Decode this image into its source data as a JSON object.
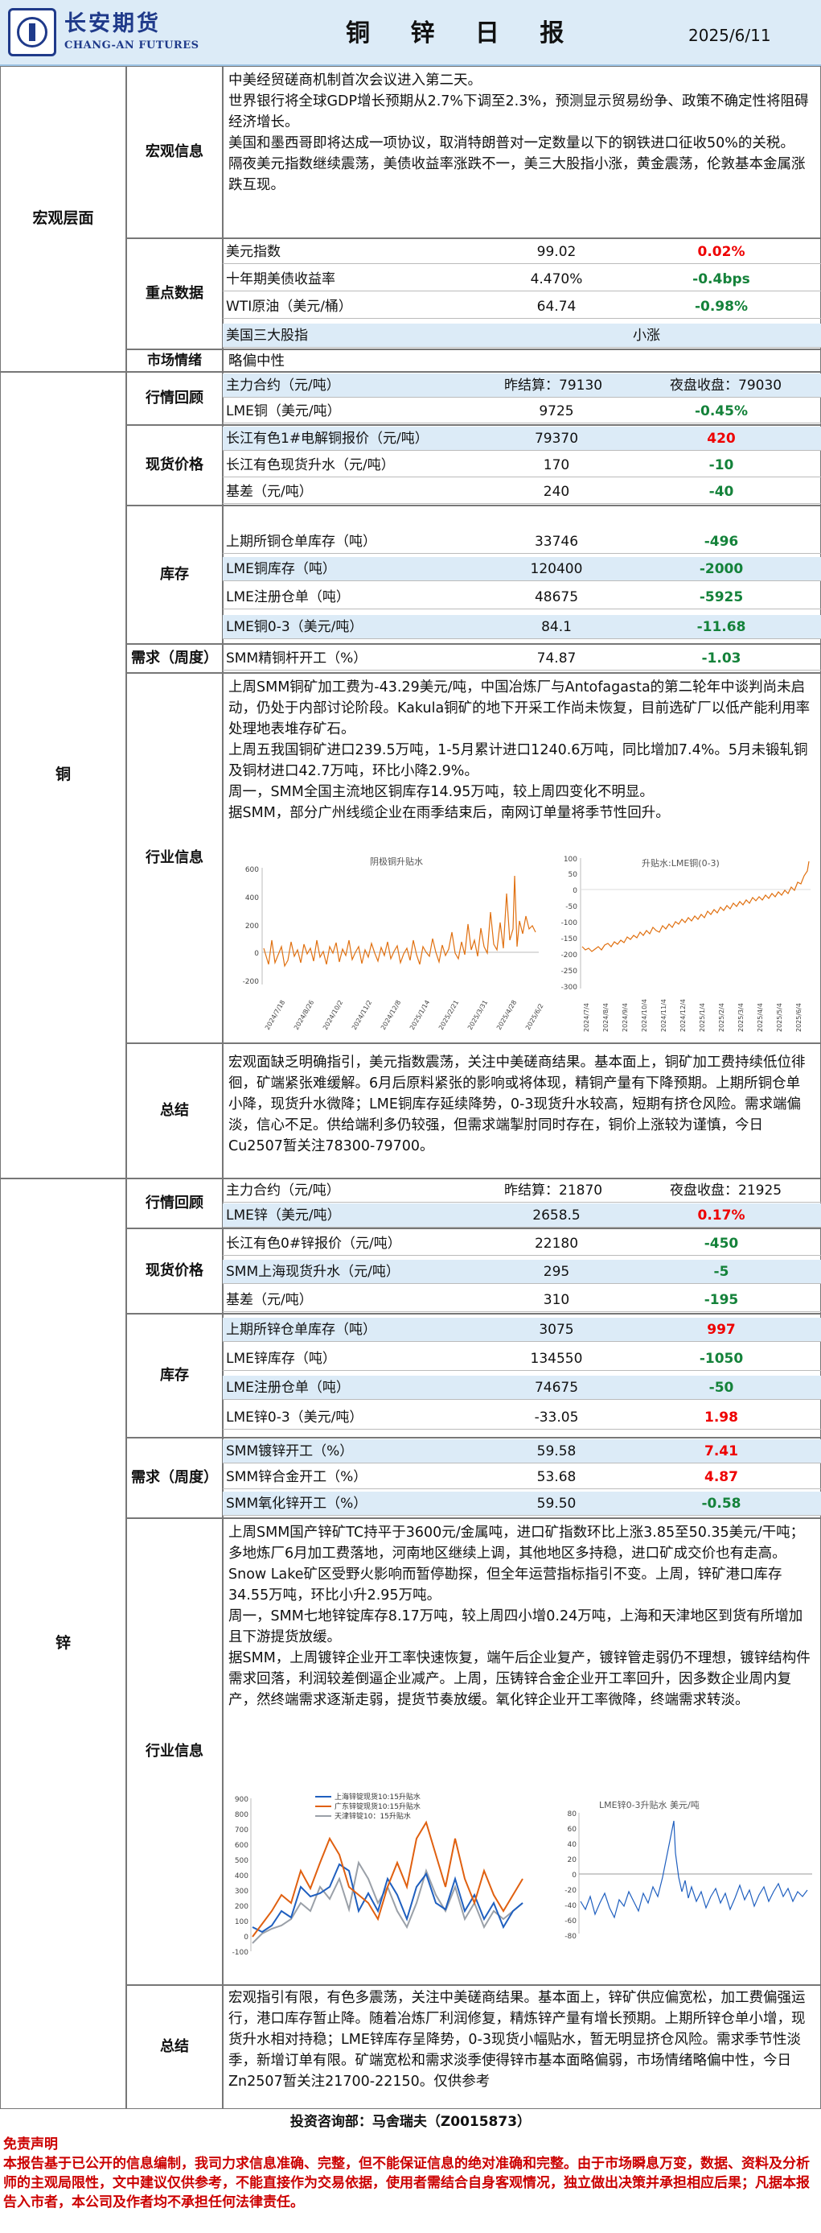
{
  "header": {
    "brand_cn": "长安期货",
    "brand_en": "CHANG-AN FUTURES",
    "title": "铜 锌 日 报",
    "date": "2025/6/11"
  },
  "macro": {
    "category": "宏观层面",
    "info_label": "宏观信息",
    "info_text": [
      "中美经贸磋商机制首次会议进入第二天。",
      "世界银行将全球GDP增长预期从2.7%下调至2.3%，预测显示贸易纷争、政策不确定性将阻碍经济增长。",
      "美国和墨西哥即将达成一项协议，取消特朗普对一定数量以下的钢铁进口征收50%的关税。",
      "隔夜美元指数继续震荡，美债收益率涨跌不一，美三大股指小涨，黄金震荡，伦敦基本金属涨跌互现。"
    ],
    "key_label": "重点数据",
    "key_rows": [
      {
        "label": "美元指数",
        "value": "99.02",
        "change": "0.02%",
        "dir": "up"
      },
      {
        "label": "十年期美债收益率",
        "value": "4.470%",
        "change": "-0.4bps",
        "dir": "down"
      },
      {
        "label": "WTI原油（美元/桶）",
        "value": "64.74",
        "change": "-0.98%",
        "dir": "down"
      },
      {
        "label": "美国三大股指",
        "value": "",
        "change": "小涨",
        "dir": "flat"
      }
    ],
    "sentiment_label": "市场情绪",
    "sentiment_value": "略偏中性"
  },
  "copper": {
    "category": "铜",
    "review_label": "行情回顾",
    "review_rows": [
      {
        "label": "主力合约（元/吨）",
        "settle": "昨结算：79130",
        "night": "夜盘收盘：79030"
      },
      {
        "label": "LME铜（美元/吨）",
        "value": "9725",
        "change": "-0.45%"
      }
    ],
    "spot_label": "现货价格",
    "spot_rows": [
      {
        "label": "长江有色1#电解铜报价（元/吨）",
        "value": "79370",
        "change": "420",
        "dir": "up"
      },
      {
        "label": "长江有色现货升水（元/吨）",
        "value": "170",
        "change": "-10",
        "dir": "down"
      },
      {
        "label": "基差（元/吨）",
        "value": "240",
        "change": "-40",
        "dir": "down"
      }
    ],
    "stock_label": "库存",
    "stock_rows": [
      {
        "label": "上期所铜仓单库存（吨）",
        "value": "33746",
        "change": "-496",
        "dir": "down"
      },
      {
        "label": "LME铜库存（吨）",
        "value": "120400",
        "change": "-2000",
        "dir": "down"
      },
      {
        "label": "LME注册仓单（吨）",
        "value": "48675",
        "change": "-5925",
        "dir": "down"
      },
      {
        "label": "LME铜0-3（美元/吨）",
        "value": "84.1",
        "change": "-11.68",
        "dir": "down"
      }
    ],
    "demand_label": "需求（周度）",
    "demand_rows": [
      {
        "label": "SMM精铜杆开工（%）",
        "value": "74.87",
        "change": "-1.03",
        "dir": "down"
      }
    ],
    "industry_label": "行业信息",
    "industry_text": [
      "上周SMM铜矿加工费为-43.29美元/吨，中国冶炼厂与Antofagasta的第二轮年中谈判尚未启动，仍处于内部讨论阶段。Kakula铜矿的地下开采工作尚未恢复，目前选矿厂以低产能利用率处理地表堆存矿石。",
      "上周五我国铜矿进口239.5万吨，1-5月累计进口1240.6万吨，同比增加7.4%。5月未锻轧铜及铜材进口42.7万吨，环比小降2.9%。",
      "周一，SMM全国主流地区铜库存14.95万吨，较上周四变化不明显。",
      "据SMM，部分广州线缆企业在雨季结束后，南网订单量将季节性回升。"
    ],
    "summary_label": "总结",
    "summary_text": "宏观面缺乏明确指引，美元指数震荡，关注中美磋商结果。基本面上，铜矿加工费持续低位徘徊，矿端紧张难缓解。6月后原料紧张的影响或将体现，精铜产量有下降预期。上期所铜仓单小降，现货升水微降；LME铜库存延续降势，0-3现货升水较高，短期有挤仓风险。需求端偏淡，信心不足。供给端利多仍较强，但需求端掣肘同时存在，铜价上涨较为谨慎，今日Cu2507暂关注78300-79700。"
  },
  "zinc": {
    "category": "锌",
    "review_label": "行情回顾",
    "review_rows": [
      {
        "label": "主力合约（元/吨）",
        "settle": "昨结算：21870",
        "night": "夜盘收盘：21925"
      },
      {
        "label": "LME锌（美元/吨）",
        "value": "2658.5",
        "change": "0.17%"
      }
    ],
    "spot_label": "现货价格",
    "spot_rows": [
      {
        "label": "长江有色0#锌报价（元/吨）",
        "value": "22180",
        "change": "-450",
        "dir": "down"
      },
      {
        "label": "SMM上海现货升水（元/吨）",
        "value": "295",
        "change": "-5",
        "dir": "down"
      },
      {
        "label": "基差（元/吨）",
        "value": "310",
        "change": "-195",
        "dir": "down"
      }
    ],
    "stock_label": "库存",
    "stock_rows": [
      {
        "label": "上期所锌仓单库存（吨）",
        "value": "3075",
        "change": "997",
        "dir": "up"
      },
      {
        "label": "LME锌库存（吨）",
        "value": "134550",
        "change": "-1050",
        "dir": "down"
      },
      {
        "label": "LME注册仓单（吨）",
        "value": "74675",
        "change": "-50",
        "dir": "down"
      },
      {
        "label": "LME锌0-3（美元/吨）",
        "value": "-33.05",
        "change": "1.98",
        "dir": "up"
      }
    ],
    "demand_label": "需求（周度）",
    "demand_rows": [
      {
        "label": "SMM镀锌开工（%）",
        "value": "59.58",
        "change": "7.41",
        "dir": "up"
      },
      {
        "label": "SMM锌合金开工（%）",
        "value": "53.68",
        "change": "4.87",
        "dir": "up"
      },
      {
        "label": "SMM氧化锌开工（%）",
        "value": "59.50",
        "change": "-0.58",
        "dir": "down"
      }
    ],
    "industry_label": "行业信息",
    "industry_text": [
      "上周SMM国产锌矿TC持平于3600元/金属吨，进口矿指数环比上涨3.85至50.35美元/干吨；多地炼厂6月加工费落地，河南地区继续上调，其他地区多持稳，进口矿成交价也有走高。",
      "Snow Lake矿区受野火影响而暂停勘探，但全年运营指标指引不变。上周，锌矿港口库存34.55万吨，环比小升2.95万吨。",
      "周一，SMM七地锌锭库存8.17万吨，较上周四小增0.24万吨，上海和天津地区到货有所增加且下游提货放缓。",
      "据SMM，上周镀锌企业开工率快速恢复，端午后企业复产，镀锌管走弱仍不理想，镀锌结构件需求回落，利润较差倒逼企业减产。上周，压铸锌合金企业开工率回升，因多数企业周内复产，然终端需求逐渐走弱，提货节奏放缓。氧化锌企业开工率微降，终端需求转淡。"
    ],
    "summary_label": "总结",
    "summary_text": "宏观指引有限，有色多震荡，关注中美磋商结果。基本面上，锌矿供应偏宽松，加工费偏强运行，港口库存暂止降。随着冶炼厂利润修复，精炼锌产量有增长预期。上期所锌仓单小增，现货升水相对持稳；LME锌库存呈降势，0-3现货小幅贴水，暂无明显挤仓风险。需求季节性淡季，新增订单有限。矿端宽松和需求淡季使得锌市基本面略偏弱，市场情绪略偏中性，今日Zn2507暂关注21700-22150。仅供参考"
  },
  "charts": {
    "cu_left": {
      "title": "阴极铜升贴水",
      "y_ticks": [
        "600",
        "400",
        "200",
        "0",
        "-200"
      ],
      "x_ticks": [
        "2024/7/18",
        "2024/8/26",
        "2024/10/2",
        "2024/11/2",
        "2024/12/8",
        "2025/1/14",
        "2025/2/21",
        "2025/3/31",
        "2025/4/28",
        "2025/6/2"
      ]
    },
    "cu_right": {
      "title": "升贴水:LME铜(0-3)",
      "y_ticks": [
        "100",
        "50",
        "0",
        "-50",
        "-100",
        "-150",
        "-200",
        "-250",
        "-300"
      ],
      "x_ticks": [
        "2024/7/4",
        "2024/8/4",
        "2024/9/4",
        "2024/10/4",
        "2024/11/4",
        "2024/12/4",
        "2025/1/4",
        "2025/2/4",
        "2025/3/4",
        "2025/4/4",
        "2025/5/4",
        "2025/6/4"
      ]
    },
    "zn_left": {
      "legend": [
        "上海锌锭现货10:15升贴水",
        "广东锌锭现货10:15升贴水",
        "天津锌锭10：15升贴水"
      ],
      "colors": [
        "#1f5fbf",
        "#e06010",
        "#9aa0a8"
      ],
      "y_ticks": [
        "900",
        "800",
        "700",
        "600",
        "500",
        "400",
        "300",
        "200",
        "100",
        "0",
        "-100"
      ]
    },
    "zn_right": {
      "title": "LME锌0-3升贴水 美元/吨",
      "y_ticks": [
        "80",
        "60",
        "40",
        "20",
        "0",
        "-20",
        "-40",
        "-60",
        "-80"
      ]
    }
  },
  "footer": {
    "analyst": "投资咨询部：马舍瑞夫（Z0015873）",
    "disclaimer_title": "免责声明",
    "disclaimer": "本报告基于已公开的信息编制，我司力求信息准确、完整，但不能保证信息的绝对准确和完整。由于市场瞬息万变，数据、资料及分析师的主观局限性，文中建议仅供参考，不能直接作为交易依据，使用者需结合自身客观情况，独立做出决策并承担相应后果；凡据本报告入市者，本公司及作者均不承担任何法律责任。"
  }
}
